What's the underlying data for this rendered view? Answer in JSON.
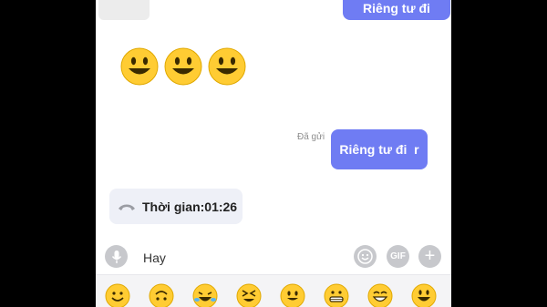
{
  "chat": {
    "messages": [
      {
        "type": "outgoing",
        "text": "Riêng tư đi"
      },
      {
        "type": "incoming-emoji",
        "emoji": [
          "grinning-face",
          "grinning-face",
          "grinning-face"
        ]
      },
      {
        "type": "outgoing",
        "text": "Riêng tư đi  r",
        "status": "Đã gửi"
      },
      {
        "type": "call",
        "icon": "phone-hangup-icon",
        "text": "Thời gian:01:26"
      }
    ]
  },
  "input_bar": {
    "mic_icon": "microphone-icon",
    "value": "Hay",
    "emoji_icon": "smiley-icon",
    "gif_label": "GIF",
    "plus_label": "+"
  },
  "emoji_tray": {
    "items": [
      "smiling-face",
      "upside-down-face",
      "rolling-on-floor-laughing",
      "squinting-face",
      "neutral-face",
      "grimacing-face",
      "beaming-face",
      "grinning-face"
    ]
  },
  "colors": {
    "accent": "#6f7cf3",
    "emoji_yellow": "#ffcc33",
    "button_gray": "#c7c8cc"
  }
}
